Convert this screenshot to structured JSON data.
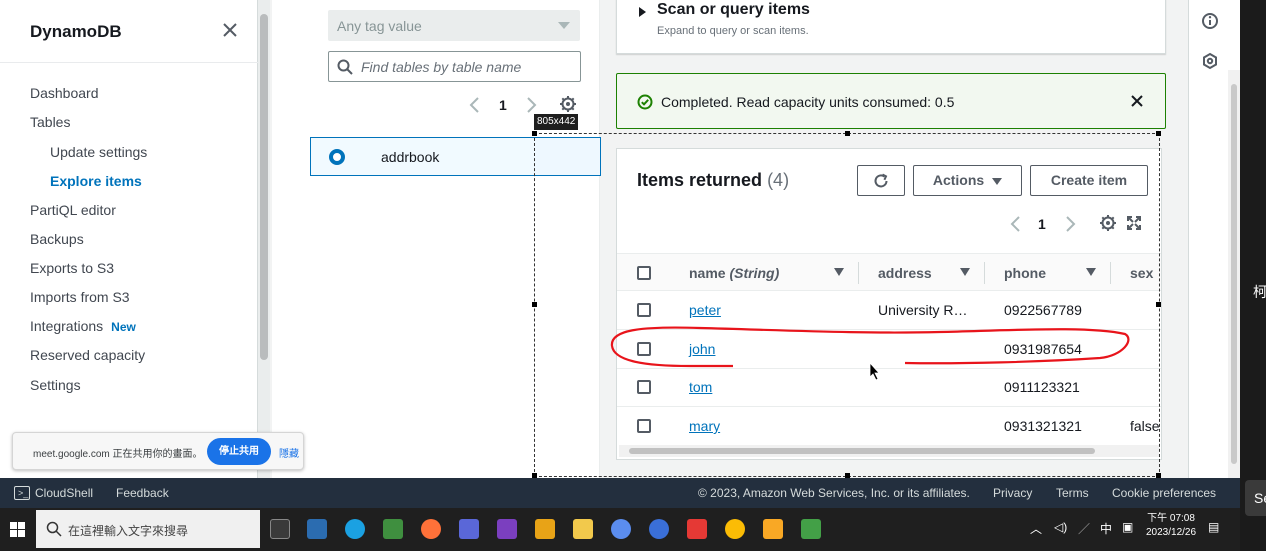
{
  "sidebar": {
    "title": "DynamoDB",
    "items": [
      {
        "label": "Dashboard"
      },
      {
        "label": "Tables"
      },
      {
        "label": "Update settings"
      },
      {
        "label": "Explore items"
      },
      {
        "label": "PartiQL editor"
      },
      {
        "label": "Backups"
      },
      {
        "label": "Exports to S3"
      },
      {
        "label": "Imports from S3"
      },
      {
        "label": "Integrations",
        "badge": "New"
      },
      {
        "label": "Reserved capacity"
      },
      {
        "label": "Settings"
      }
    ]
  },
  "share_bar": {
    "text": "meet.google.com 正在共用你的畫面。",
    "stop_label": "停止共用",
    "hide_label": "隱藏"
  },
  "tables_panel": {
    "tag_placeholder": "Any tag value",
    "search_placeholder": "Find tables by table name",
    "page": "1",
    "selected_table": "addrbook"
  },
  "scan": {
    "title": "Scan or query items",
    "subtitle": "Expand to query or scan items."
  },
  "alert": {
    "text": "Completed. Read capacity units consumed: 0.5"
  },
  "items": {
    "title": "Items returned",
    "count": "(4)",
    "actions_label": "Actions",
    "create_label": "Create item",
    "page": "1",
    "columns": [
      {
        "label": "name",
        "type": "(String)"
      },
      {
        "label": "address"
      },
      {
        "label": "phone"
      },
      {
        "label": "sex"
      }
    ],
    "rows": [
      {
        "name": "peter",
        "address": "University R…",
        "phone": "0922567789",
        "sex": ""
      },
      {
        "name": "john",
        "address": "",
        "phone": "0931987654",
        "sex": ""
      },
      {
        "name": "tom",
        "address": "",
        "phone": "0911123321",
        "sex": ""
      },
      {
        "name": "mary",
        "address": "",
        "phone": "0931321321",
        "sex": "false"
      }
    ]
  },
  "overlay": {
    "dimension_label": "805x442"
  },
  "footer": {
    "cloudshell": "CloudShell",
    "feedback": "Feedback",
    "copyright": "© 2023, Amazon Web Services, Inc. or its affiliates.",
    "privacy": "Privacy",
    "terms": "Terms",
    "cookies": "Cookie preferences"
  },
  "taskbar": {
    "search_placeholder": "在這裡輸入文字來搜尋",
    "ime": "中",
    "time": "下午 07:08",
    "date": "2023/12/26"
  },
  "edge": {
    "char1": "柯",
    "char2": "Se"
  },
  "colors": {
    "aws_blue": "#0073bb",
    "success_green": "#1d8102",
    "footer_bg": "#232f3e",
    "annotation_red": "#e8141b"
  }
}
